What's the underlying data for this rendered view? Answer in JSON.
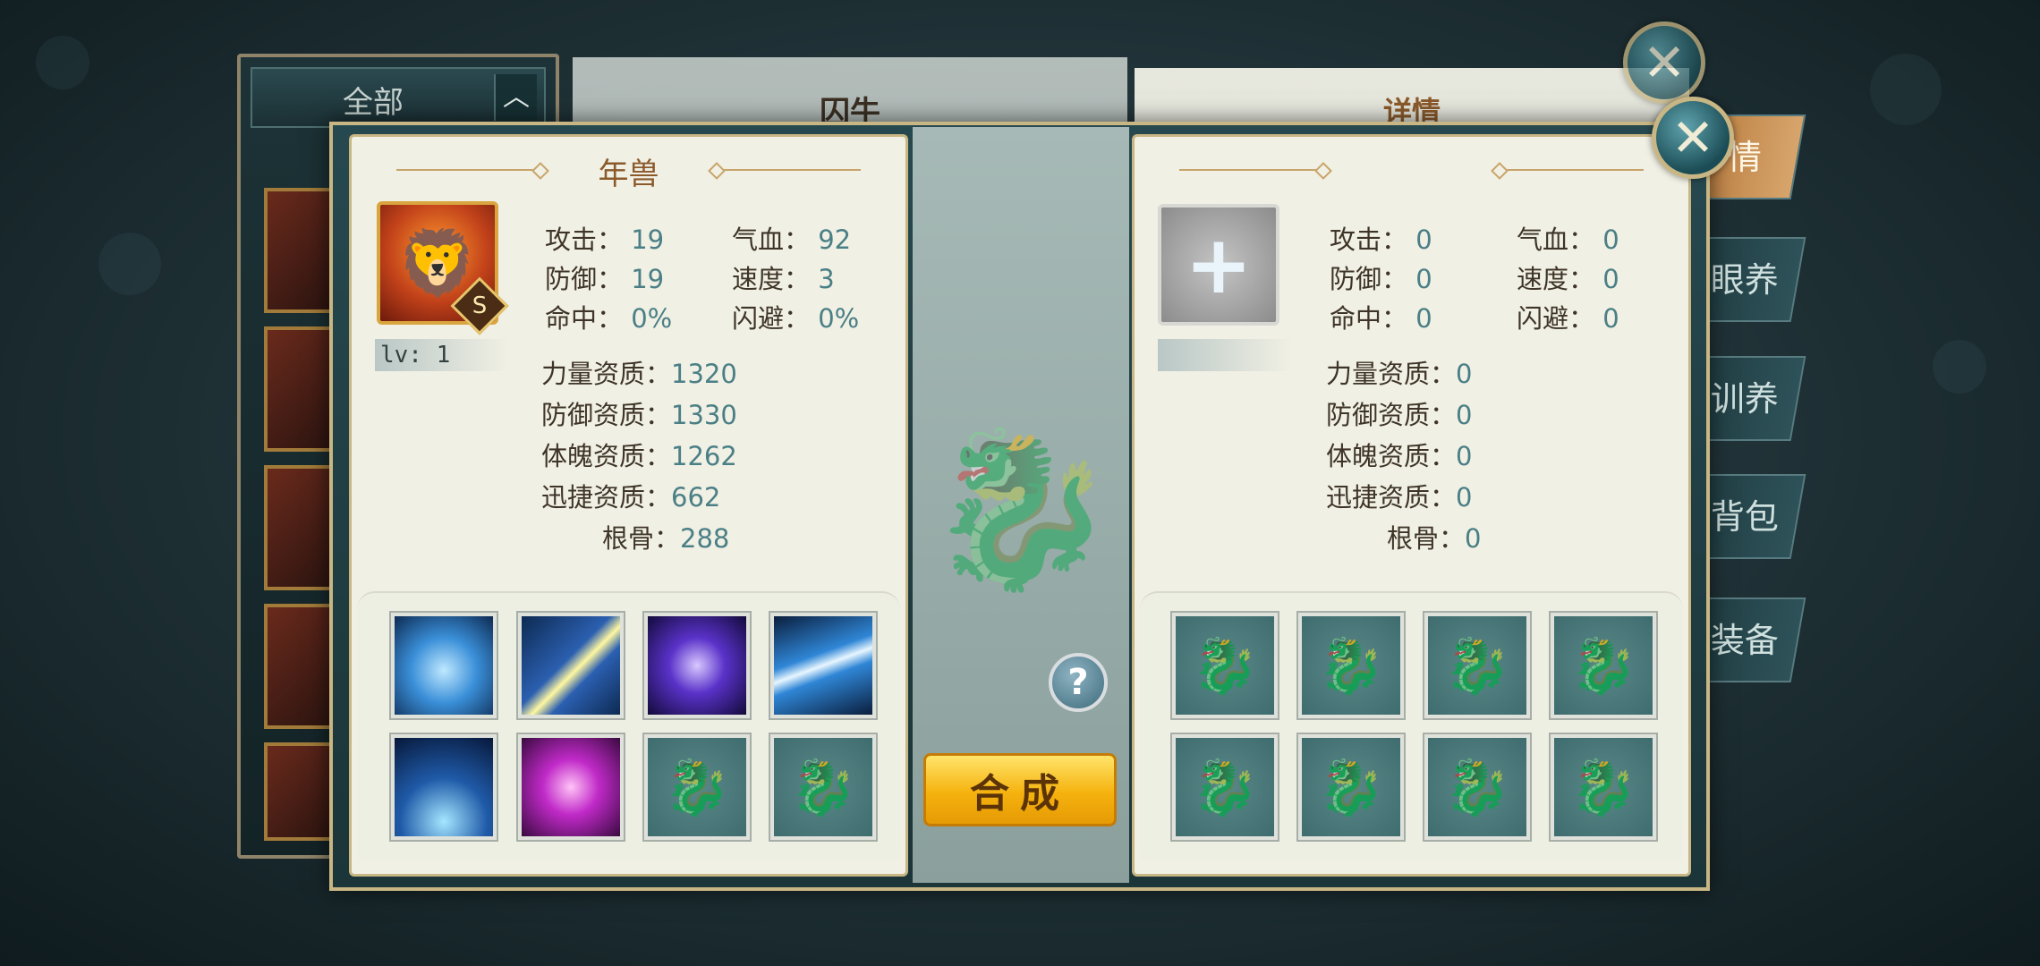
{
  "background": {
    "filter_label": "全部",
    "center_title": "囚牛",
    "right_title": "详情",
    "side_tabs": [
      "情",
      "眼养",
      "训养",
      "背包",
      "装备"
    ]
  },
  "dialog": {
    "left": {
      "name": "年兽",
      "grade": "S",
      "level": "lv: 1",
      "stats": {
        "attack_label": "攻击：",
        "attack": "19",
        "hp_label": "气血：",
        "hp": "92",
        "defense_label": "防御：",
        "defense": "19",
        "speed_label": "速度：",
        "speed": "3",
        "hit_label": "命中：",
        "hit": "0%",
        "dodge_label": "闪避：",
        "dodge": "0%"
      },
      "aptitudes": {
        "strength_label": "力量资质：",
        "strength": "1320",
        "defense_label": "防御资质：",
        "defense": "1330",
        "physique_label": "体魄资质：",
        "physique": "1262",
        "agility_label": "迅捷资质：",
        "agility": "662",
        "bone_label": "根骨：",
        "bone": "288"
      },
      "skills": [
        {
          "icon": "heart-water-skill-icon",
          "color": "#3a8fd8"
        },
        {
          "icon": "slash-strike-skill-icon",
          "color": "#2b5fb0"
        },
        {
          "icon": "purple-vortex-skill-icon",
          "color": "#5a32c9"
        },
        {
          "icon": "lightning-skill-icon",
          "color": "#2f86d6"
        },
        {
          "icon": "ice-spikes-skill-icon",
          "color": "#1f5aa8"
        },
        {
          "icon": "magenta-vortex-skill-icon",
          "color": "#c02ac8"
        },
        {
          "icon": "empty-slot-icon",
          "color": ""
        },
        {
          "icon": "empty-slot-icon",
          "color": ""
        }
      ]
    },
    "right": {
      "stats": {
        "attack_label": "攻击：",
        "attack": "0",
        "hp_label": "气血：",
        "hp": "0",
        "defense_label": "防御：",
        "defense": "0",
        "speed_label": "速度：",
        "speed": "0",
        "hit_label": "命中：",
        "hit": "0",
        "dodge_label": "闪避：",
        "dodge": "0"
      },
      "aptitudes": {
        "strength_label": "力量资质：",
        "strength": "0",
        "defense_label": "防御资质：",
        "defense": "0",
        "physique_label": "体魄资质：",
        "physique": "0",
        "agility_label": "迅捷资质：",
        "agility": "0",
        "bone_label": "根骨：",
        "bone": "0"
      }
    },
    "help_label": "?",
    "combine_label": "合成"
  }
}
